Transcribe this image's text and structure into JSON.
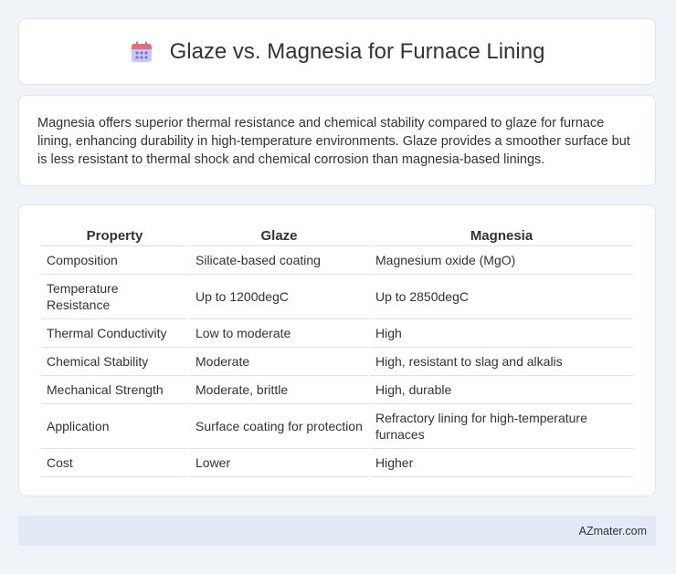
{
  "header": {
    "title": "Glaze vs. Magnesia for Furnace Lining",
    "icon": "calendar-icon",
    "icon_colors": {
      "top": "#e86f6f",
      "body": "#a8a6e8",
      "dots": "#6f6cd6"
    }
  },
  "summary": {
    "text": "Magnesia offers superior thermal resistance and chemical stability compared to glaze for furnace lining, enhancing durability in high-temperature environments. Glaze provides a smoother surface but is less resistant to thermal shock and chemical corrosion than magnesia-based linings."
  },
  "table": {
    "headers": [
      "Property",
      "Glaze",
      "Magnesia"
    ],
    "rows": [
      [
        "Composition",
        "Silicate-based coating",
        "Magnesium oxide (MgO)"
      ],
      [
        "Temperature Resistance",
        "Up to 1200degC",
        "Up to 2850degC"
      ],
      [
        "Thermal Conductivity",
        "Low to moderate",
        "High"
      ],
      [
        "Chemical Stability",
        "Moderate",
        "High, resistant to slag and alkalis"
      ],
      [
        "Mechanical Strength",
        "Moderate, brittle",
        "High, durable"
      ],
      [
        "Application",
        "Surface coating for protection",
        "Refractory lining for high-temperature furnaces"
      ],
      [
        "Cost",
        "Lower",
        "Higher"
      ]
    ]
  },
  "footer": {
    "brand": "AZmater.com"
  }
}
